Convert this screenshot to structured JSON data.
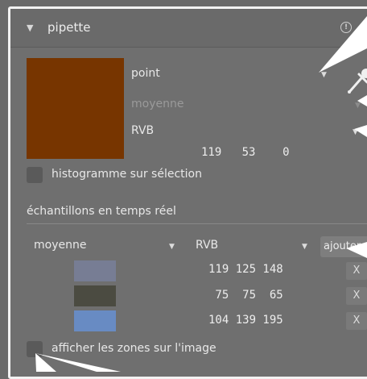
{
  "module": {
    "title": "pipette",
    "collapse_icon": "triangle-down-icon",
    "info_icon": "info-circle-icon"
  },
  "picker": {
    "color_hex": "#773500",
    "mode": "point",
    "statistic": "moyenne",
    "colorspace": "RVB",
    "values": "119   53    0",
    "picker_icon": "eyedropper-icon"
  },
  "histogram_checkbox": {
    "label": "histogramme sur sélection",
    "checked": false
  },
  "live_samples": {
    "section_title": "échantillons en temps réel",
    "statistic": "moyenne",
    "colorspace": "RVB",
    "add_label": "ajouter",
    "rows": [
      {
        "color": "#777d94",
        "values": "119 125 148",
        "remove_label": "X"
      },
      {
        "color": "#4b4b41",
        "values": " 75  75  65",
        "remove_label": "X"
      },
      {
        "color": "#688bc3",
        "values": "104 139 195",
        "remove_label": "X"
      }
    ]
  },
  "overlay_checkbox": {
    "label": "afficher les zones sur l'image",
    "checked": false
  }
}
